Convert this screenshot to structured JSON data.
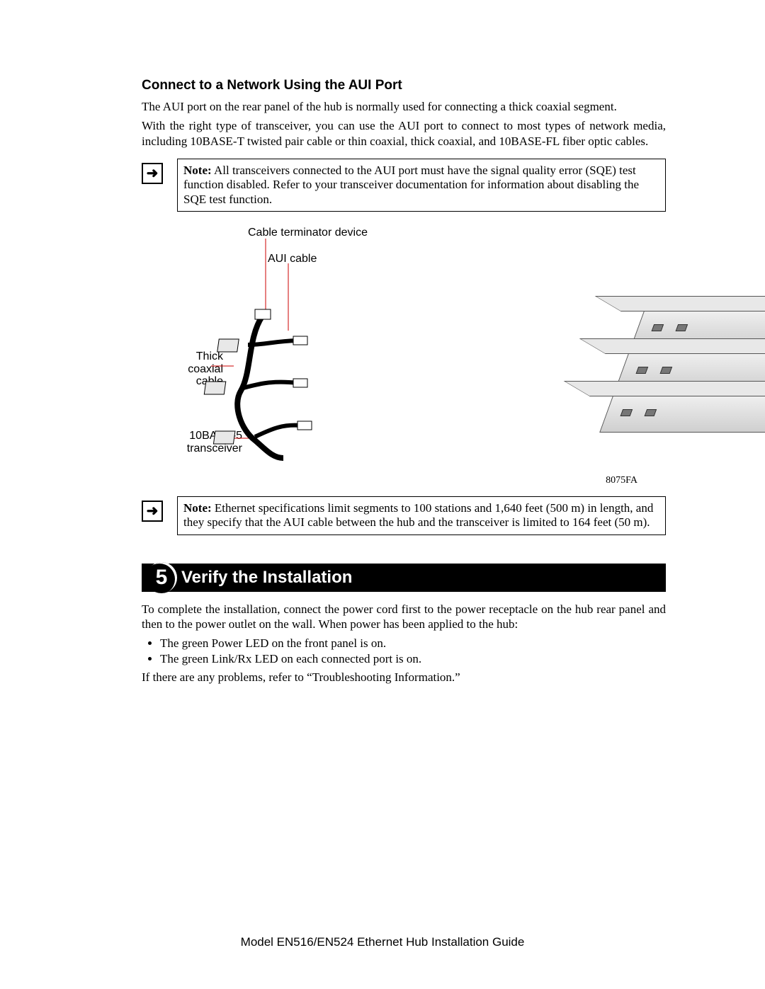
{
  "section1": {
    "title": "Connect to a Network Using the AUI Port",
    "p1": "The AUI port on the rear panel of the hub is normally used for connecting a thick coaxial segment.",
    "p2": "With the right type of transceiver, you can use the AUI port to connect to most types of network media, including 10BASE-T twisted pair cable or thin coaxial, thick coaxial, and 10BASE-FL fiber optic cables."
  },
  "note1": {
    "label": "Note:",
    "text": " All transceivers connected to the AUI port must have the signal quality error (SQE) test function disabled. Refer to your transceiver documentation for information about disabling the SQE test function."
  },
  "figure": {
    "l_terminator": "Cable terminator device",
    "l_aui": "AUI cable",
    "l_thick1": "Thick",
    "l_thick2": "coaxial",
    "l_thick3": "cable",
    "l_xcvr1": "10BASE-5",
    "l_xcvr2": "transceiver",
    "code": "8075FA"
  },
  "note2": {
    "label": "Note:",
    "text": " Ethernet specifications limit segments to 100 stations and 1,640 feet (500 m) in length, and they specify that the AUI cable between the hub and the transceiver is limited to 164 feet (50 m)."
  },
  "step": {
    "num": "5",
    "title": "Verify the Installation",
    "p1": "To complete the installation, connect the power cord first to the power receptacle on the hub rear panel and then to the power outlet on the wall. When power has been applied to the hub:",
    "b1": "The green Power LED on the front panel is on.",
    "b2": "The green Link/Rx LED on each connected port is on.",
    "p2": "If there are any problems, refer to “Troubleshooting Information.”"
  },
  "footer": "Model EN516/EN524 Ethernet Hub Installation Guide",
  "icons": {
    "arrow": "➜"
  }
}
